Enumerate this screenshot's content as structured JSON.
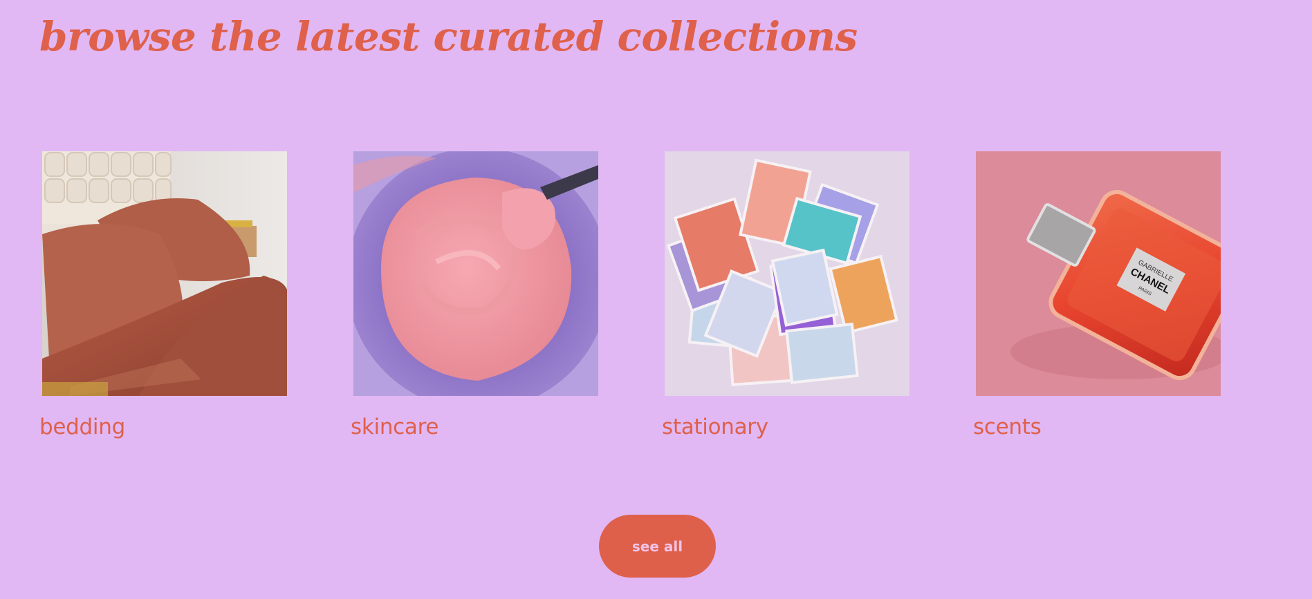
{
  "section": {
    "heading": "browse the latest curated collections"
  },
  "collections": [
    {
      "label": "bedding",
      "image": "bedding-photo"
    },
    {
      "label": "skincare",
      "image": "pink-cream-bowl-photo"
    },
    {
      "label": "stationary",
      "image": "scattered-cards-photo"
    },
    {
      "label": "scents",
      "image": "perfume-bottle-photo"
    }
  ],
  "perfume_label": {
    "line1": "GABRIELLE",
    "line2": "CHANEL",
    "line3": "PARIS"
  },
  "actions": {
    "see_all_label": "see all"
  },
  "colors": {
    "background": "#e1b8f3",
    "accent": "#df604b",
    "button_text": "#f2c3e7"
  }
}
